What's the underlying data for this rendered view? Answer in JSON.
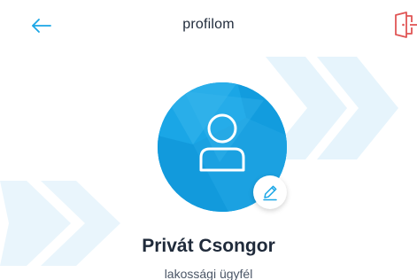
{
  "header": {
    "title": "profilom",
    "back_icon": "arrow-left-icon",
    "logout_icon": "logout-door-icon"
  },
  "profile": {
    "name": "Privát Csongor",
    "role": "lakossági ügyfél",
    "avatar_icon": "user-icon",
    "edit_icon": "pencil-icon"
  },
  "colors": {
    "accent": "#1aa6e6",
    "logout": "#e05555",
    "chevron": "#e3f3fc",
    "text": "#1f2a3a"
  }
}
